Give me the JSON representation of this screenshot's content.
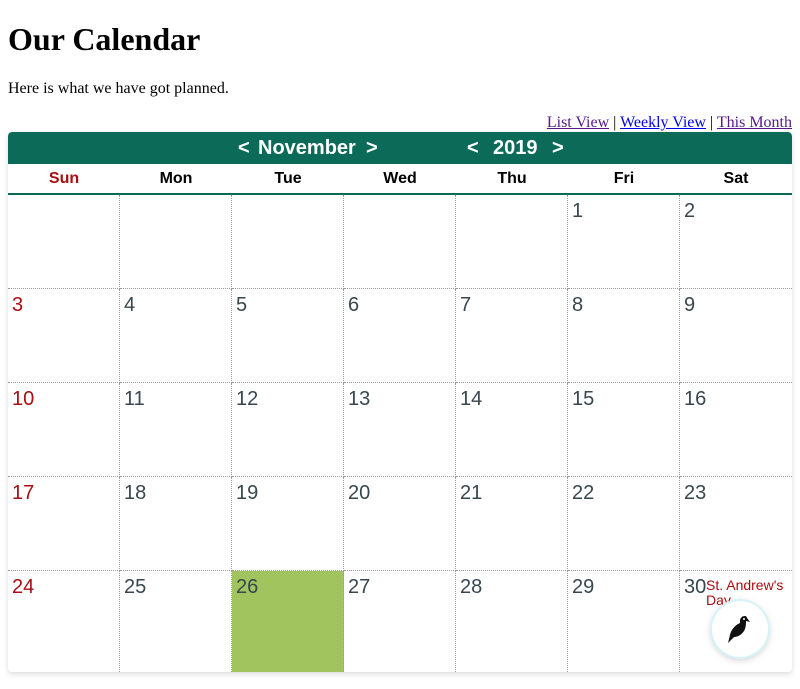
{
  "page": {
    "title": "Our Calendar",
    "intro": "Here is what we have got planned."
  },
  "views": {
    "list": "List View",
    "sep1": "|",
    "weekly": "Weekly View",
    "sep2": "|",
    "this_month": "This Month"
  },
  "calendar": {
    "prev_symbol": "<",
    "next_symbol": ">",
    "month": "November",
    "year": "2019",
    "days_of_week": [
      "Sun",
      "Mon",
      "Tue",
      "Wed",
      "Thu",
      "Fri",
      "Sat"
    ],
    "weeks": [
      [
        "",
        "",
        "",
        "",
        "",
        "1",
        "2"
      ],
      [
        "3",
        "4",
        "5",
        "6",
        "7",
        "8",
        "9"
      ],
      [
        "10",
        "11",
        "12",
        "13",
        "14",
        "15",
        "16"
      ],
      [
        "17",
        "18",
        "19",
        "20",
        "21",
        "22",
        "23"
      ],
      [
        "24",
        "25",
        "26",
        "27",
        "28",
        "29",
        "30"
      ]
    ],
    "today": "26",
    "events": [
      {
        "day": "30",
        "title": "St. Andrew's Day"
      }
    ]
  },
  "colors": {
    "header_bg": "#0b6b58",
    "sunday_text": "#a80d10",
    "today_bg": "#a1c45f",
    "day_text": "#37474f"
  },
  "fab": {
    "icon": "bird-icon"
  }
}
